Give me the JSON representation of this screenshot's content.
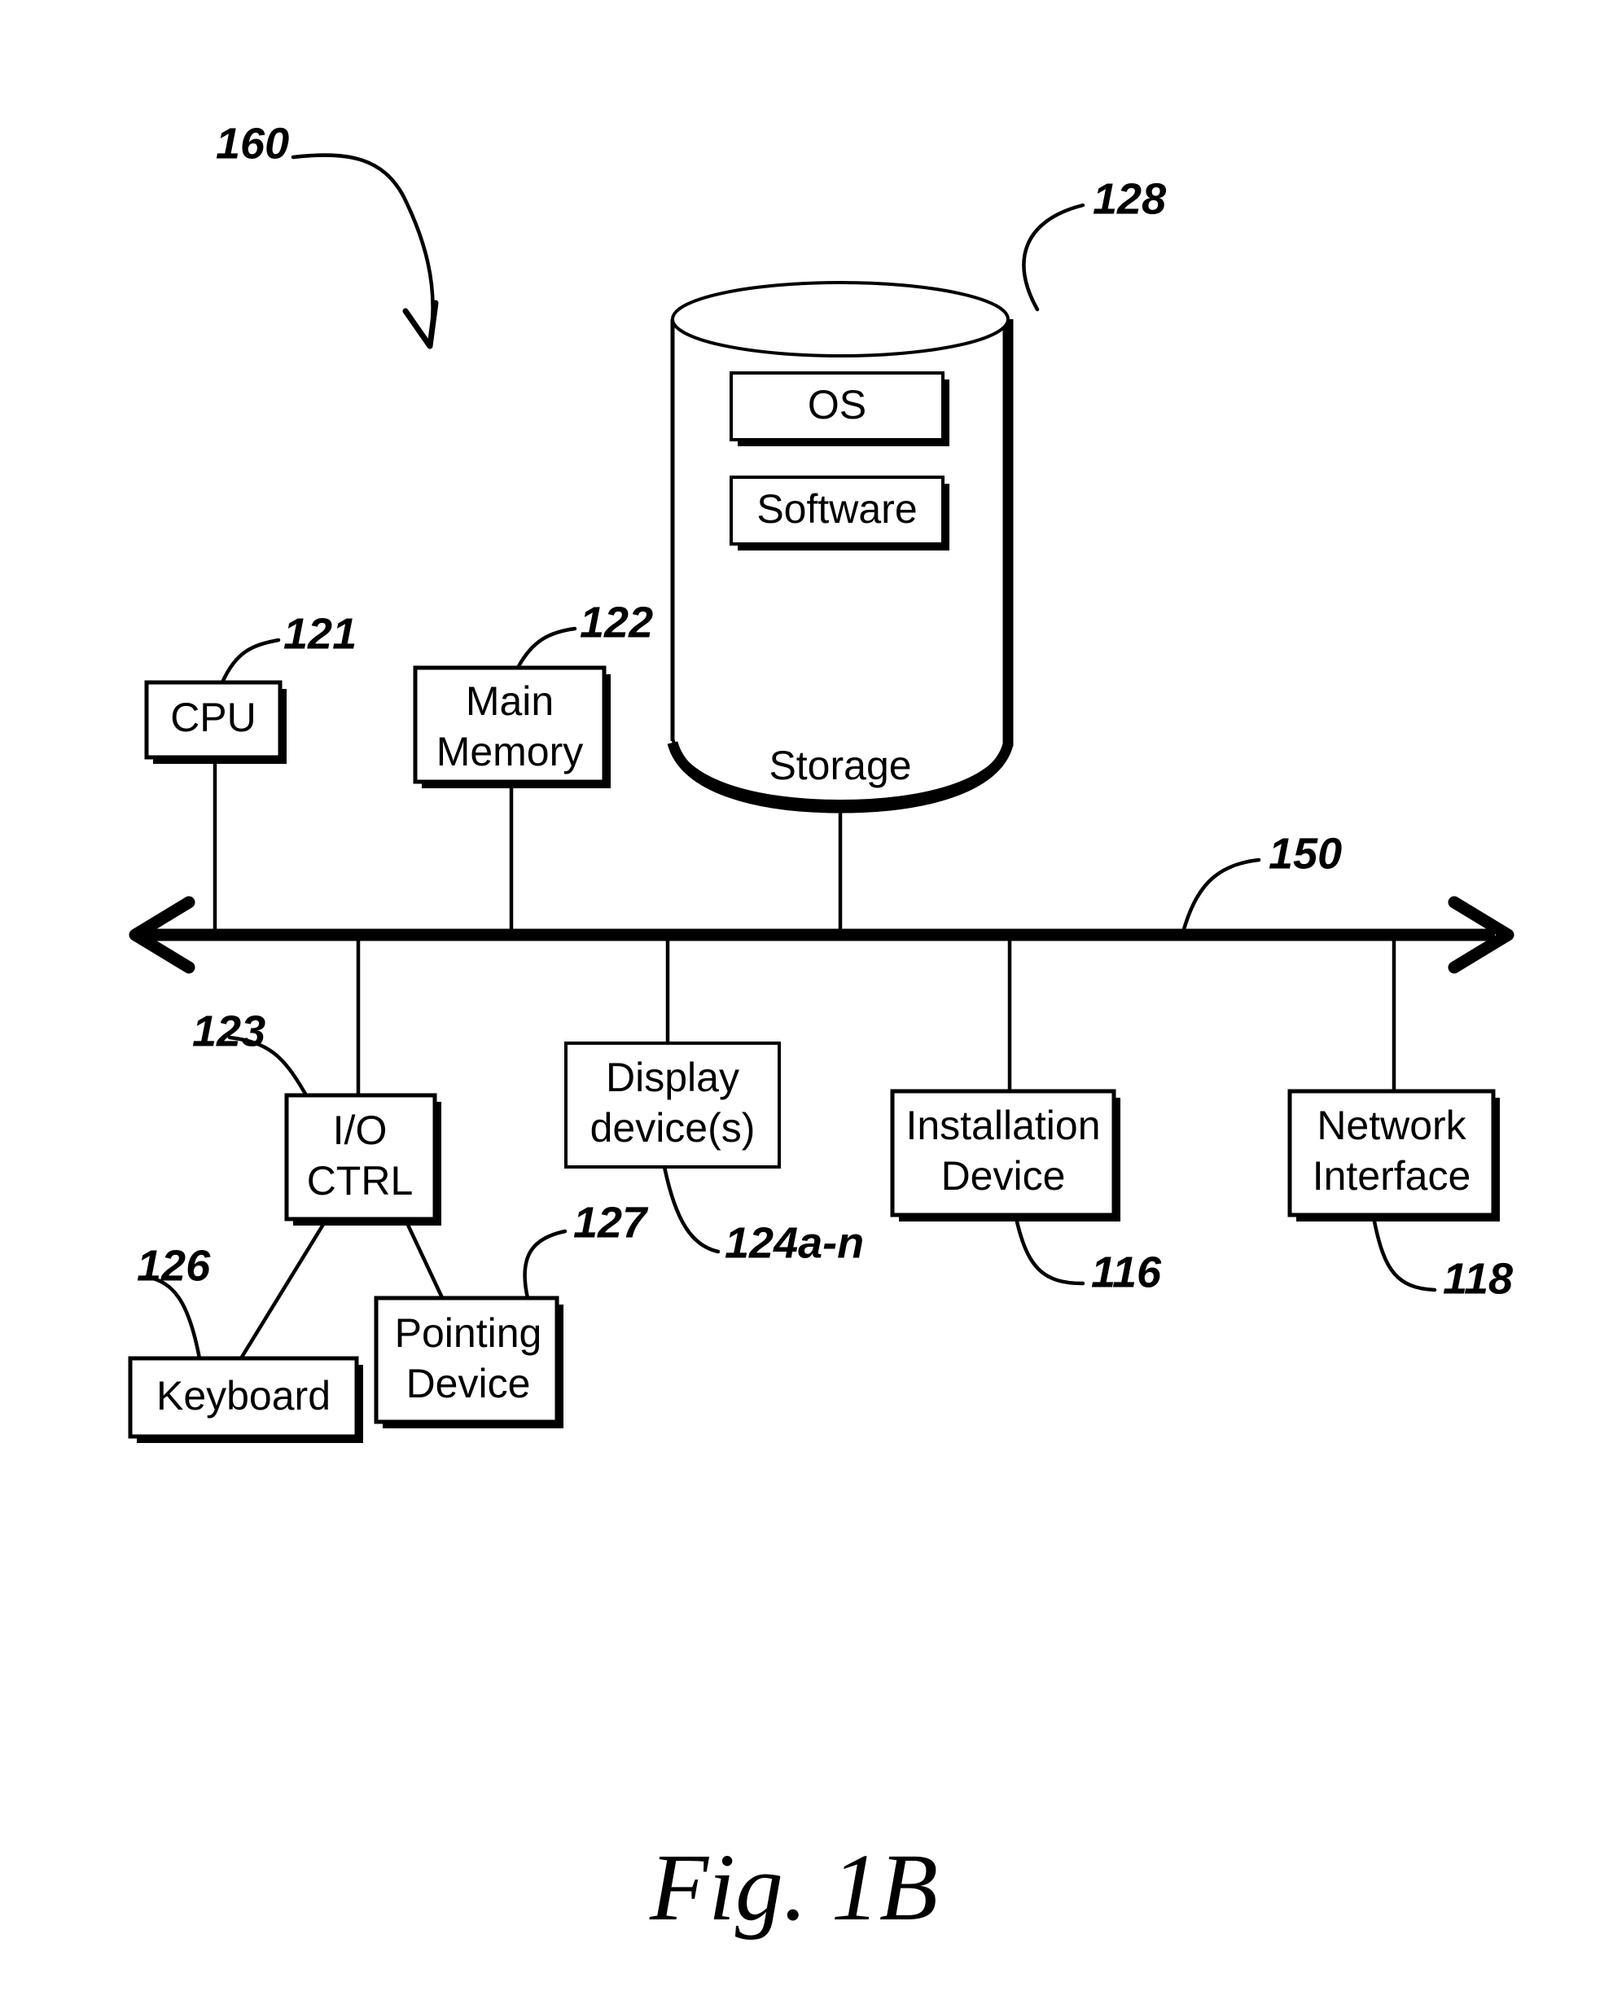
{
  "figure": {
    "caption": "Fig. 1B",
    "system_ref": "160"
  },
  "nodes": {
    "cpu": {
      "label": "CPU",
      "ref": "121"
    },
    "main_memory": {
      "label_line1": "Main",
      "label_line2": "Memory",
      "ref": "122"
    },
    "storage": {
      "label": "Storage",
      "ref": "128"
    },
    "os": {
      "label": "OS"
    },
    "software": {
      "label": "Software"
    },
    "bus": {
      "ref": "150"
    },
    "io_ctrl": {
      "label_line1": "I/O",
      "label_line2": "CTRL",
      "ref": "123"
    },
    "display_devices": {
      "label_line1": "Display",
      "label_line2": "device(s)",
      "ref": "124a-n"
    },
    "installation_device": {
      "label_line1": "Installation",
      "label_line2": "Device",
      "ref": "116"
    },
    "network_interface": {
      "label_line1": "Network",
      "label_line2": "Interface",
      "ref": "118"
    },
    "keyboard": {
      "label": "Keyboard",
      "ref": "126"
    },
    "pointing_device": {
      "label_line1": "Pointing",
      "label_line2": "Device",
      "ref": "127"
    }
  },
  "colors": {
    "ink": "#000000",
    "paper": "#ffffff"
  }
}
